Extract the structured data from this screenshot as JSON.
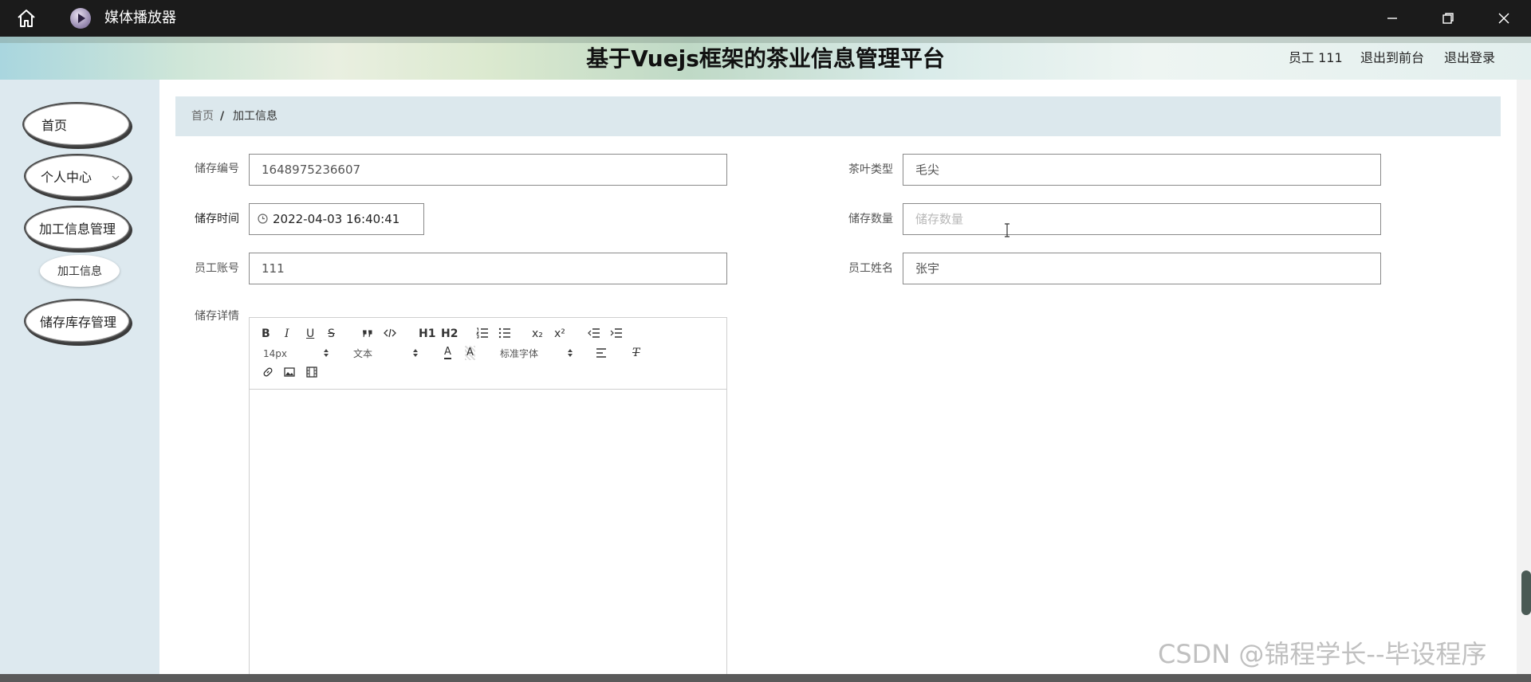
{
  "window": {
    "app_title": "媒体播放器"
  },
  "header": {
    "site_title": "基于Vuejs框架的茶业信息管理平台",
    "user": "员工 111",
    "exit_front": "退出到前台",
    "logout": "退出登录"
  },
  "sidebar": {
    "items": [
      {
        "label": "首页"
      },
      {
        "label": "个人中心"
      },
      {
        "label": "加工信息管理"
      },
      {
        "label": "加工信息"
      },
      {
        "label": "储存库存管理"
      }
    ]
  },
  "breadcrumb": {
    "home": "首页",
    "separator": "/",
    "current": "加工信息"
  },
  "form": {
    "storage_no": {
      "label": "储存编号",
      "value": "1648975236607"
    },
    "tea_type": {
      "label": "茶叶类型",
      "value": "毛尖"
    },
    "storage_time": {
      "label": "储存时间",
      "value": "2022-04-03 16:40:41"
    },
    "storage_qty": {
      "label": "储存数量",
      "placeholder": "储存数量"
    },
    "staff_account": {
      "label": "员工账号",
      "value": "111"
    },
    "staff_name": {
      "label": "员工姓名",
      "value": "张宇"
    },
    "storage_detail": {
      "label": "储存详情"
    }
  },
  "editor": {
    "bold": "B",
    "italic": "I",
    "underline": "U",
    "strike": "S",
    "h1": "H1",
    "h2": "H2",
    "sub": "x₂",
    "sup": "x²",
    "size_value": "14px",
    "format_value": "文本",
    "font_value": "标准字体",
    "color_letter": "A",
    "bg_letter": "A",
    "clean": "T"
  },
  "watermark": "CSDN @锦程学长--毕设程序"
}
